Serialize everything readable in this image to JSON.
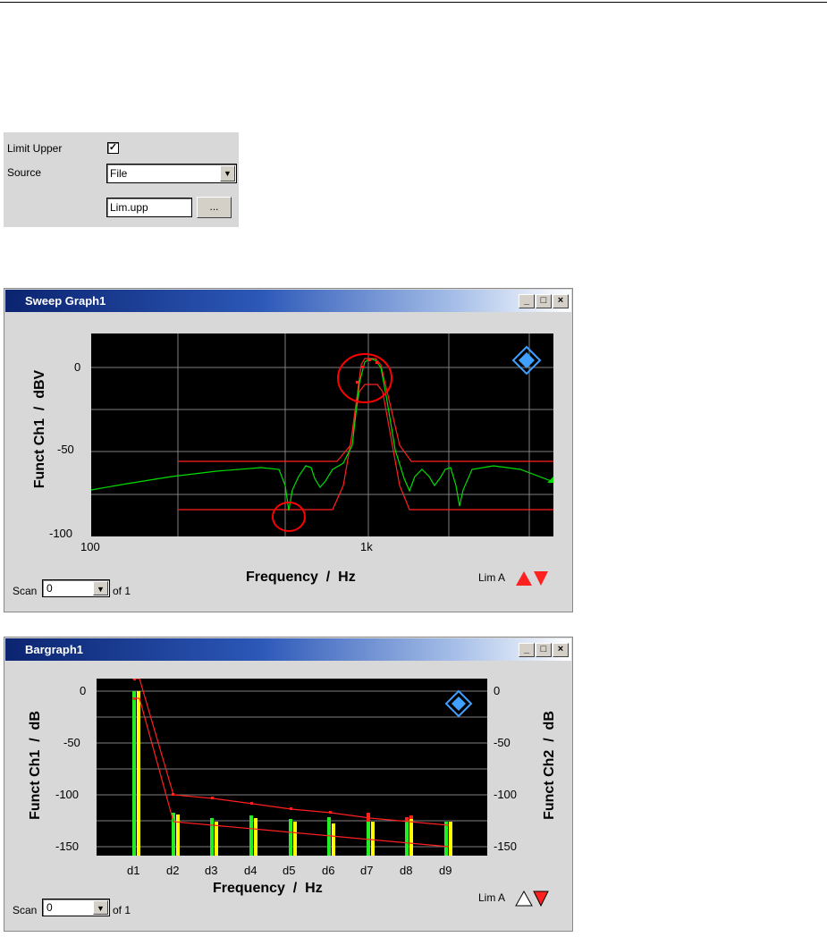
{
  "settings": {
    "limit_upper_label": "Limit Upper",
    "limit_upper_checked": true,
    "source_label": "Source",
    "source_value": "File",
    "file_value": "Lim.upp",
    "browse_label": "..."
  },
  "sweep_window": {
    "title": "Sweep Graph1",
    "y_axis_label": "Funct Ch1  /  dBV",
    "x_axis_label": "Frequency  /  Hz",
    "y_ticks": [
      "0",
      "-50",
      "-100"
    ],
    "x_ticks": [
      "100",
      "1k"
    ],
    "scan_label": "Scan",
    "scan_value": "0",
    "scan_of": "of 1",
    "limit_label": "Lim A",
    "colors": {
      "trace": "#00dd00",
      "limit": "#ff2020",
      "grid": "#808080",
      "marker": "#ff0000"
    }
  },
  "bar_window": {
    "title": "Bargraph1",
    "y_axis_label": "Funct Ch1  /  dB",
    "y2_axis_label": "Funct Ch2  /  dB",
    "x_axis_label": "Frequency  /  Hz",
    "y_ticks": [
      "0",
      "-50",
      "-100",
      "-150"
    ],
    "y2_ticks": [
      "0",
      "-50",
      "-100",
      "-150"
    ],
    "x_ticks": [
      "d1",
      "d2",
      "d3",
      "d4",
      "d5",
      "d6",
      "d7",
      "d8",
      "d9"
    ],
    "scan_label": "Scan",
    "scan_value": "0",
    "scan_of": "of 1",
    "limit_label": "Lim A",
    "colors": {
      "ch1": "#22ee22",
      "ch2": "#ffff00",
      "limit": "#ff2020"
    }
  },
  "window_buttons": {
    "minimize": "_",
    "maximize": "□",
    "close": "×"
  }
}
